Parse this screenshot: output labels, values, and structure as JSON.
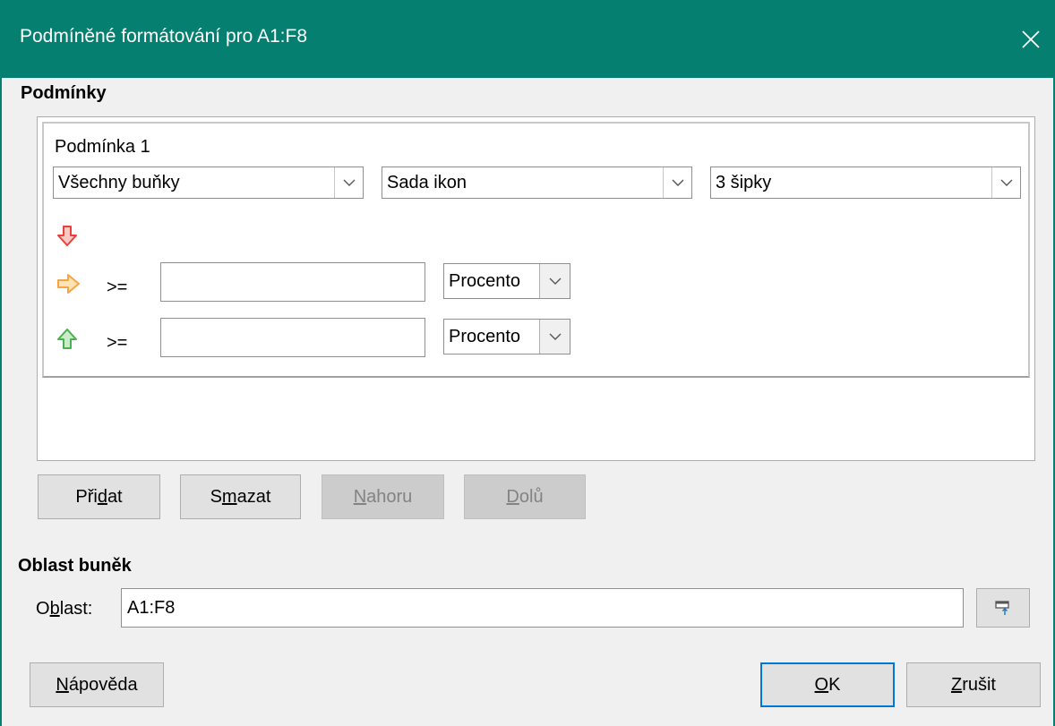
{
  "window": {
    "title": "Podmíněné formátování pro A1:F8"
  },
  "conditions_section": {
    "label": "Podmínky",
    "condition": {
      "title": "Podmínka 1",
      "applies_to": "Všechny buňky",
      "type": "Sada ikon",
      "icon_set": "3 šipky",
      "rows": [
        {
          "icon": "arrow-down-red-icon",
          "operator": "",
          "value": "",
          "unit": ""
        },
        {
          "icon": "arrow-right-orange-icon",
          "operator": ">=",
          "value": "",
          "unit": "Procento"
        },
        {
          "icon": "arrow-up-green-icon",
          "operator": ">=",
          "value": "",
          "unit": "Procento"
        }
      ]
    },
    "buttons": {
      "add": {
        "pre": "Při",
        "acc": "d",
        "post": "at"
      },
      "delete": {
        "pre": "S",
        "acc": "m",
        "post": "azat"
      },
      "up": {
        "pre": "",
        "acc": "N",
        "post": "ahoru"
      },
      "down": {
        "pre": "",
        "acc": "D",
        "post": "olů"
      }
    }
  },
  "cell_range_section": {
    "label": "Oblast buněk",
    "field_label": {
      "pre": "O",
      "acc": "b",
      "post": "last:"
    },
    "value": "A1:F8"
  },
  "footer": {
    "help": {
      "pre": "",
      "acc": "N",
      "post": "ápověda"
    },
    "ok": {
      "pre": "",
      "acc": "O",
      "post": "K"
    },
    "cancel": {
      "pre": "",
      "acc": "Z",
      "post": "rušit"
    }
  },
  "colors": {
    "titlebar": "#047f70",
    "arrow_down": "#e8413a",
    "arrow_right": "#f4a640",
    "arrow_up": "#4caf50",
    "default_button_border": "#0078d7"
  }
}
